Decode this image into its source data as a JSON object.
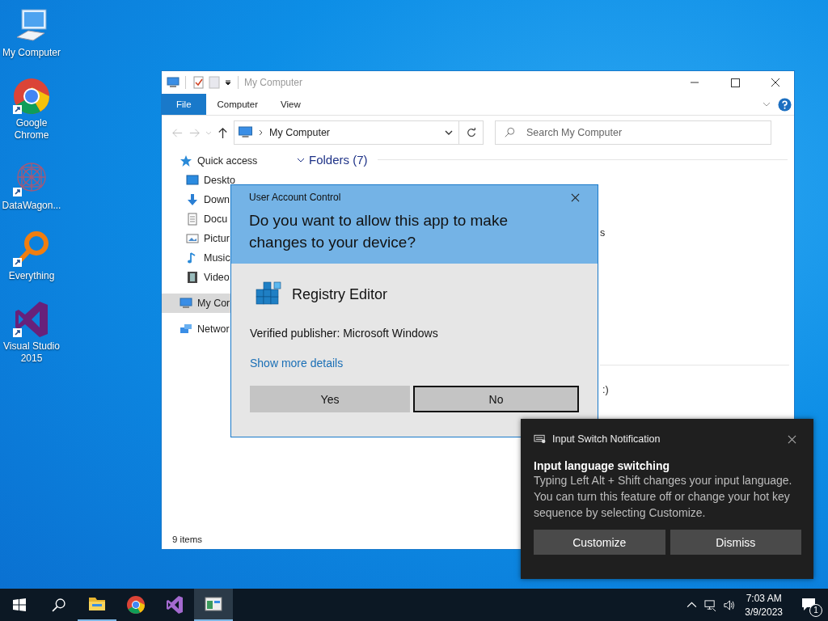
{
  "desktop_icons": [
    {
      "label": "My Computer",
      "kind": "computer"
    },
    {
      "label": "Google Chrome",
      "kind": "chrome"
    },
    {
      "label": "DataWagon...",
      "kind": "mesh"
    },
    {
      "label": "Everything",
      "kind": "magnifier"
    },
    {
      "label": "Visual Studio 2015",
      "kind": "vs"
    }
  ],
  "explorer": {
    "title": "My Computer",
    "ribbon_tabs": [
      {
        "label": "File",
        "selected": true
      },
      {
        "label": "Computer",
        "selected": false
      },
      {
        "label": "View",
        "selected": false
      }
    ],
    "address": "My Computer",
    "search_placeholder": "Search My Computer",
    "group_heading": "Folders (7)",
    "nav_items": [
      {
        "label": "Quick access",
        "kind": "star",
        "selected": false,
        "children": [
          {
            "label": "Deskto",
            "kind": "desktop",
            "selected": false
          },
          {
            "label": "Down",
            "kind": "download",
            "selected": false
          },
          {
            "label": "Docu",
            "kind": "document",
            "selected": false
          },
          {
            "label": "Pictur",
            "kind": "picture",
            "selected": false
          },
          {
            "label": "Music",
            "kind": "music",
            "selected": false
          },
          {
            "label": "Video",
            "kind": "video",
            "selected": false
          }
        ]
      },
      {
        "label": "My Cor",
        "kind": "computer",
        "selected": true
      },
      {
        "label": "Networ",
        "kind": "network",
        "selected": false
      }
    ],
    "content_fragments": [
      "s",
      ":)"
    ],
    "status": "9 items"
  },
  "uac": {
    "title": "User Account Control",
    "question": "Do you want to allow this app to make changes to your device?",
    "app_name": "Registry Editor",
    "publisher": "Verified publisher: Microsoft Windows",
    "details_link": "Show more details",
    "buttons": [
      {
        "label": "Yes",
        "focused": false
      },
      {
        "label": "No",
        "focused": true
      }
    ]
  },
  "notification": {
    "app": "Input Switch Notification",
    "title": "Input language switching",
    "body": "Typing Left Alt + Shift changes your input language. You can turn this feature off or change your hot key sequence by selecting Customize.",
    "buttons": [
      "Customize",
      "Dismiss"
    ]
  },
  "taskbar": {
    "apps": [
      {
        "kind": "folder",
        "running": true,
        "active": false
      },
      {
        "kind": "chrome",
        "running": false,
        "active": false
      },
      {
        "kind": "vs",
        "running": false,
        "active": false
      },
      {
        "kind": "regedit",
        "running": true,
        "active": true
      }
    ],
    "time": "7:03 AM",
    "date": "3/9/2023",
    "notification_count": "1"
  }
}
